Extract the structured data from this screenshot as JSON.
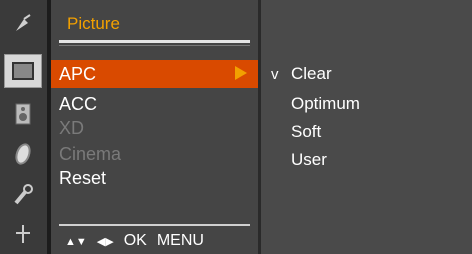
{
  "menu": {
    "title": "Picture",
    "items": [
      {
        "label": "APC",
        "state": "selected"
      },
      {
        "label": "ACC",
        "state": "enabled"
      },
      {
        "label": "XD",
        "state": "disabled"
      },
      {
        "label": "Cinema",
        "state": "disabled"
      },
      {
        "label": "Reset",
        "state": "enabled"
      }
    ],
    "footer": {
      "updown": "▲▼",
      "leftright": "◀▶",
      "ok": "OK",
      "menu": "MENU"
    }
  },
  "submenu": {
    "checkmark": "v",
    "options": [
      "Clear",
      "Optimum",
      "Soft",
      "User"
    ],
    "selected": "Clear"
  },
  "icons": [
    "satellite-icon",
    "picture-icon",
    "speaker-icon",
    "clock-icon",
    "wrench-icon",
    "antenna-icon"
  ],
  "colors": {
    "accent": "#f2a000",
    "highlight": "#d94a00",
    "panel": "#454545"
  }
}
